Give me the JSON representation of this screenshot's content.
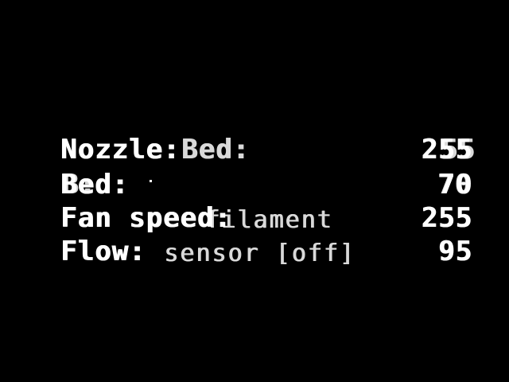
{
  "screen": {
    "background": "#000000",
    "foreground": "#ffffff"
  },
  "lines": [
    {
      "label": "Nozzle:",
      "label_overlap": "Bed:",
      "value": "255",
      "value_overlap": "55"
    },
    {
      "label": "Bed:",
      "label_overlap": "B:",
      "value": "70",
      "value_overlap": "70"
    },
    {
      "label": "Fan speed:",
      "label_overlap": "filament",
      "value": "255",
      "value_overlap": ""
    },
    {
      "label": "Flow:",
      "label_overlap": "sensor [off]",
      "value": "95",
      "value_overlap": ""
    }
  ]
}
